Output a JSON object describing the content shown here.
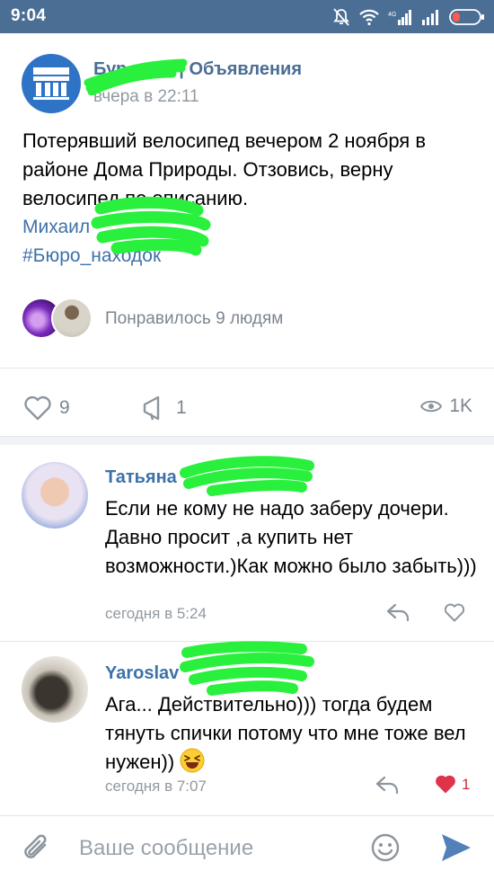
{
  "status_bar": {
    "time": "9:04"
  },
  "post": {
    "group_name": "Объявления",
    "time": "вчера в 22:11",
    "text": "Потерявший велосипед вечером 2 ноября в районе Дома Природы. Отзовись, верну велосипед по описанию.",
    "author_link": "Михаил",
    "hashtag": "#Бюро_находок",
    "likers_text": "Понравилось 9 людям",
    "likes": "9",
    "shares": "1",
    "views": "1K"
  },
  "comments": [
    {
      "author": "Татьяна",
      "text": "Если не кому не надо заберу дочери. Давно просит ,а купить нет возможности.)Как можно было забыть)))",
      "time": "сегодня в 5:24",
      "likes": ""
    },
    {
      "author": "Yaroslav",
      "text": "Ага... Действительно))) тогда будем тянуть спички потому что мне тоже вел нужен))",
      "time": "сегодня в 7:07",
      "likes": "1"
    }
  ],
  "composer": {
    "placeholder": "Ваше сообщение"
  },
  "colors": {
    "status_bar": "#4a6e94",
    "link": "#3e71a8",
    "liked": "#e0334a",
    "send": "#5181b8"
  },
  "icons": [
    "silent-icon",
    "wifi-icon",
    "signal-icon",
    "battery-icon",
    "heart-icon",
    "share-icon",
    "eye-icon",
    "reply-icon",
    "attach-icon",
    "emoji-icon",
    "send-icon"
  ]
}
